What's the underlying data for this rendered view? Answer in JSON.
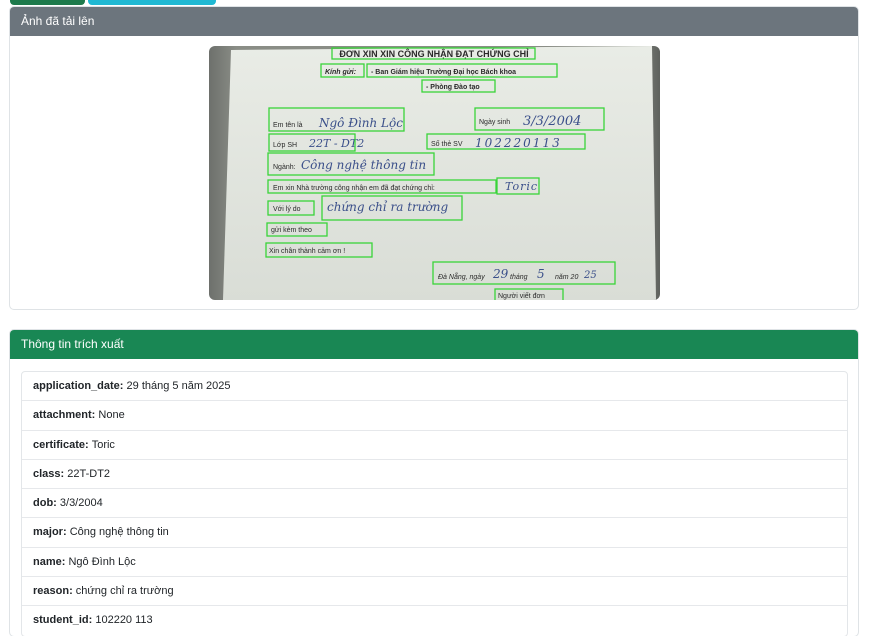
{
  "tabs": [
    {
      "color": "#1e7a4c"
    },
    {
      "color": "#1fb8d3"
    }
  ],
  "upload_card": {
    "title": "Ảnh đã tải lên",
    "header_color": "#6c757d"
  },
  "document": {
    "title": "ĐƠN XIN XIN CÔNG NHẬN ĐẠT CHỨNG CHỈ",
    "kinh_gui": "Kính gửi:",
    "recipient_1": "- Ban Giám hiệu Trường Đại học Bách khoa",
    "recipient_2": "- Phòng Đào tạo",
    "name_label": "Em tên là",
    "name_value": "Ngô Đình Lộc",
    "dob_label": "Ngày sinh",
    "dob_value": "3/3/2004",
    "class_label": "Lớp SH",
    "class_value": "22T - DT2",
    "student_id_label": "Số thẻ SV",
    "student_id_value": "102220113",
    "major_label": "Ngành:",
    "major_value": "Công nghệ thông tin",
    "request_text": "Em xin Nhà trường công nhận em đã đạt chứng chỉ:",
    "certificate_value": "Toric",
    "reason_label": "Với lý do",
    "reason_value": "chứng chỉ ra trường",
    "attachment_label": "gửi kèm theo",
    "thanks": "Xin chân thành cảm ơn !",
    "date_line_prefix": "Đà Nẵng, ngày",
    "date_day": "29",
    "date_month_label": "tháng",
    "date_month": "5",
    "date_year_label": "năm 20",
    "date_year": "25",
    "signer": "Người viết đơn",
    "box_color": "#39d439"
  },
  "extract_card": {
    "title": "Thông tin trích xuất",
    "header_color": "#198754",
    "rows": [
      {
        "key": "application_date:",
        "value": "29 tháng 5 năm 2025"
      },
      {
        "key": "attachment:",
        "value": "None"
      },
      {
        "key": "certificate:",
        "value": "Toric"
      },
      {
        "key": "class:",
        "value": "22T-DT2"
      },
      {
        "key": "dob:",
        "value": "3/3/2004"
      },
      {
        "key": "major:",
        "value": "Công nghệ thông tin"
      },
      {
        "key": "name:",
        "value": "Ngô Đình Lộc"
      },
      {
        "key": "reason:",
        "value": "chứng chỉ ra trường"
      },
      {
        "key": "student_id:",
        "value": "102220 113"
      }
    ]
  }
}
